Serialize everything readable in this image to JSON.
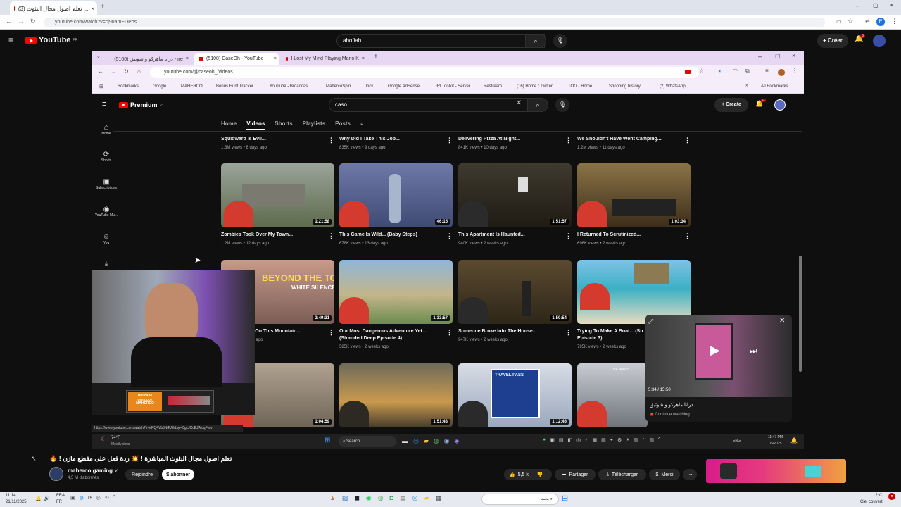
{
  "outer_browser": {
    "tab_title": "(3) تعلم اصول مجال البثوث ...",
    "url": "youtube.com/watch?v=cj9uamEDPos"
  },
  "outer_youtube": {
    "logo_text": "YouTube",
    "logo_sup": "FR",
    "search_value": "abofiah",
    "create_label": "Créer",
    "notif_count": "3"
  },
  "inner_browser": {
    "tabs": [
      {
        "label": "درانا ماهركو و شوتيق (5100) - ne"
      },
      {
        "label": "(5108) CaseOh - YouTube"
      },
      {
        "label": "I Lost My Mind Playing Mario K"
      }
    ],
    "url": "youtube.com/@caseoh_/videos",
    "bookmarks": [
      "Bookmarks",
      "Google",
      "MAHERCO",
      "Bonus Hunt Tracker",
      "YouTube - Broadcas...",
      "MahercoSpin",
      "kick",
      "Google AdSense",
      "IRLToolkit - Server",
      "Restream",
      "(16) Home / Twitter",
      "TOO - Home",
      "Shopping history",
      "(2) WhatsApp",
      "All Bookmarks"
    ]
  },
  "inner_youtube": {
    "logo_text": "Premium",
    "logo_sup": "JO",
    "search_value": "caso",
    "create_label": "Create",
    "notif_count": "9+",
    "sidebar": [
      "Home",
      "Shorts",
      "Subscriptions",
      "YouTube Mu...",
      "You"
    ],
    "channel_tabs": [
      "Home",
      "Videos",
      "Shorts",
      "Playlists",
      "Posts"
    ],
    "active_tab": "Videos",
    "top_row": [
      {
        "title": "Squidward Is Evil...",
        "meta": "1.3M views • 8 days ago"
      },
      {
        "title": "Why Did I Take This Job...",
        "meta": "835K views • 9 days ago"
      },
      {
        "title": "Delivering Pizza At Night...",
        "meta": "841K views • 10 days ago"
      },
      {
        "title": "We Shouldn't Have Went Camping...",
        "meta": "1.2M views • 11 days ago"
      }
    ],
    "row2": [
      {
        "title": "Zombies Took Over My Town...",
        "meta": "1.2M views • 12 days ago",
        "duration": "1:21:58"
      },
      {
        "title": "This Game Is Wild... (Baby Steps)",
        "meta": "678K views • 13 days ago",
        "duration": "46:15"
      },
      {
        "title": "This Apartment Is Haunted...",
        "meta": "940K views • 2 weeks ago",
        "duration": "1:51:57"
      },
      {
        "title": "I Returned To Scrutinized...",
        "meta": "696K views • 2 weeks ago",
        "duration": "1:03:34"
      }
    ],
    "row3": [
      {
        "title": "...ear On This Mountain...",
        "meta": "...eeks ago",
        "duration": "2:49:31",
        "overlay": "BEYOND THE TOMB",
        "overlay2": "WHITE SILENCE"
      },
      {
        "title": "Our Most Dangerous Adventure Yet... (Stranded Deep Episode 4)",
        "line1": "Our Most Dangerous Adventure Yet...",
        "line2": "(Stranded Deep Episode 4)",
        "meta": "585K views • 2 weeks ago",
        "duration": "1:33:57"
      },
      {
        "title": "Someone Broke Into The House...",
        "meta": "947K views • 2 weeks ago",
        "duration": "1:50:54"
      },
      {
        "title": "Trying To Make A Boat... (Stranded Deep Episode 3)",
        "line1": "Trying To Make A Boat... (Str",
        "line2": "Episode 3)",
        "meta": "795K views • 2 weeks ago"
      }
    ],
    "row4": [
      {
        "duration": "1:04:59"
      },
      {
        "duration": "1:51:43"
      },
      {
        "duration": "1:12:46",
        "overlay": "TRAVEL PASS"
      },
      {
        "overlay": "THE WARS"
      }
    ],
    "miniplayer": {
      "time": "5:34 / 15:50",
      "title": "درانا ماهركو و شوتيق",
      "continue": "Continue watching"
    },
    "status_url": "https://www.youtube.com/watch?v=ePQ4Vb5N4UE&pp=0gcJCcEJAfcqFhrv"
  },
  "inner_taskbar": {
    "weather_temp": "74°F",
    "weather_desc": "Mostly clear",
    "search": "Search",
    "lang": "ENG",
    "time": "11:47 PM",
    "date": "7/6/2025"
  },
  "webcam": {
    "sponsor": "Hellcase",
    "code_label": "USE CODE",
    "code": "MAHERCO"
  },
  "video": {
    "title": "🔥 ! تعلم اصول مجال البثوث المباشرة ! 💥 ردة فعل على مقطع مازن",
    "channel": "maherco gaming",
    "subs": "4,5 M d'abonnés",
    "join": "Rejoindre",
    "subscribe": "S'abonner",
    "likes": "5,5 k",
    "share": "Partager",
    "download": "Télécharger",
    "thanks": "Merci"
  },
  "os_taskbar": {
    "lang": "FRA",
    "lang2": "FR",
    "time": "11:14",
    "date": "21/11/2025",
    "temp": "12°C",
    "weather": "Ciel couvert",
    "search": "بحث"
  }
}
